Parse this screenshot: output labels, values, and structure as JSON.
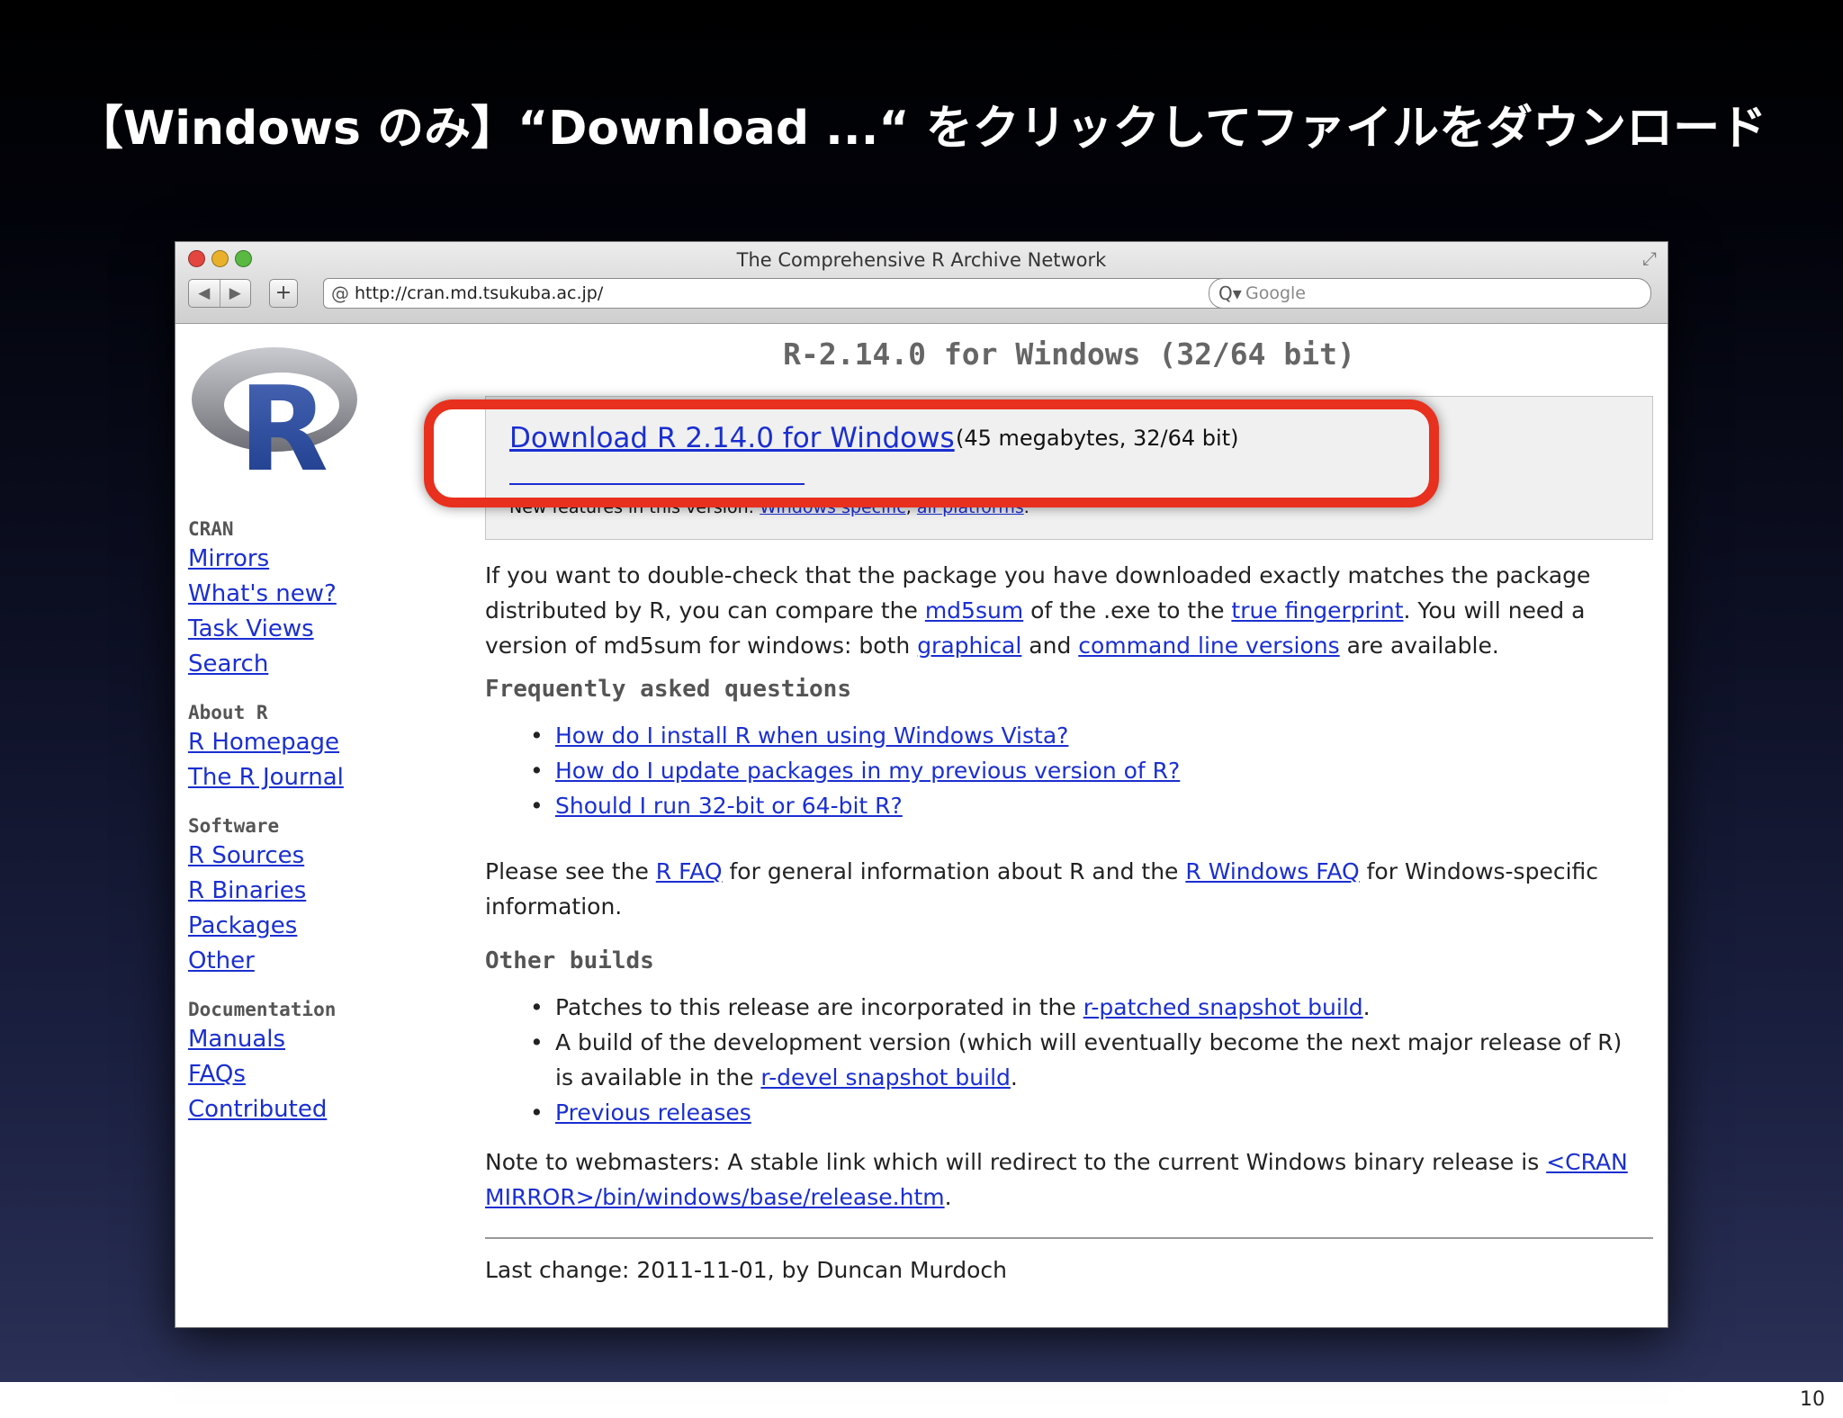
{
  "slide": {
    "title": "【Windows のみ】“Download ...“ をクリックしてファイルをダウンロード",
    "page_number": "10"
  },
  "browser": {
    "window_title": "The Comprehensive R Archive Network",
    "url": "http://cran.md.tsukuba.ac.jp/",
    "search_placeholder": "Google",
    "back_icon": "◀",
    "forward_icon": "▶",
    "add_icon": "+",
    "reload_icon": "↻",
    "search_icon": "Q▾",
    "resize_icon": "⤢"
  },
  "sidebar": {
    "logo_text": "R",
    "sections": [
      {
        "heading": "CRAN",
        "links": [
          "Mirrors",
          "What's new?",
          "Task Views",
          "Search"
        ]
      },
      {
        "heading": "About R",
        "links": [
          "R Homepage",
          "The R Journal"
        ]
      },
      {
        "heading": "Software",
        "links": [
          "R Sources",
          "R Binaries",
          "Packages",
          "Other"
        ]
      },
      {
        "heading": "Documentation",
        "links": [
          "Manuals",
          "FAQs",
          "Contributed"
        ]
      }
    ]
  },
  "main": {
    "heading": "R-2.14.0 for Windows (32/64 bit)",
    "download": {
      "link": "Download R 2.14.0 for Windows",
      "size": "(45 megabytes, 32/64 bit)",
      "new_features_prefix": "New features in this version: ",
      "new_features_link1": "Windows specific",
      "comma": ", ",
      "new_features_link2": "all platforms",
      "period": "."
    },
    "check_para": {
      "t1": "If you want to double-check that the package you have downloaded exactly matches the package distributed by R, you can compare the ",
      "l1": "md5sum",
      "t2": " of the .exe to the ",
      "l2": "true fingerprint",
      "t3": ". You will need a version of md5sum for windows: both ",
      "l3": "graphical",
      "t4": " and ",
      "l4": "command line versions",
      "t5": " are available."
    },
    "faq_heading": "Frequently asked questions",
    "faq_items": [
      "How do I install R when using Windows Vista?",
      "How do I update packages in my previous version of R?",
      "Should I run 32-bit or 64-bit R?"
    ],
    "see_para": {
      "t1": "Please see the ",
      "l1": "R FAQ",
      "t2": " for general information about R and the ",
      "l2": "R Windows FAQ",
      "t3": " for Windows-specific information."
    },
    "other_heading": "Other builds",
    "other_items": {
      "i1_text": "Patches to this release are incorporated in the ",
      "i1_link": "r-patched snapshot build",
      "i1_end": ".",
      "i2_text": "A build of the development version (which will eventually become the next major release of R) is available in the ",
      "i2_link": "r-devel snapshot build",
      "i2_end": ".",
      "i3_link": "Previous releases"
    },
    "note_para": {
      "t1": "Note to webmasters: A stable link which will redirect to the current Windows binary release is ",
      "l1": "<CRAN MIRROR>/bin/windows/base/release.htm",
      "t2": "."
    },
    "last_change": "Last change: 2011-11-01, by Duncan Murdoch"
  }
}
